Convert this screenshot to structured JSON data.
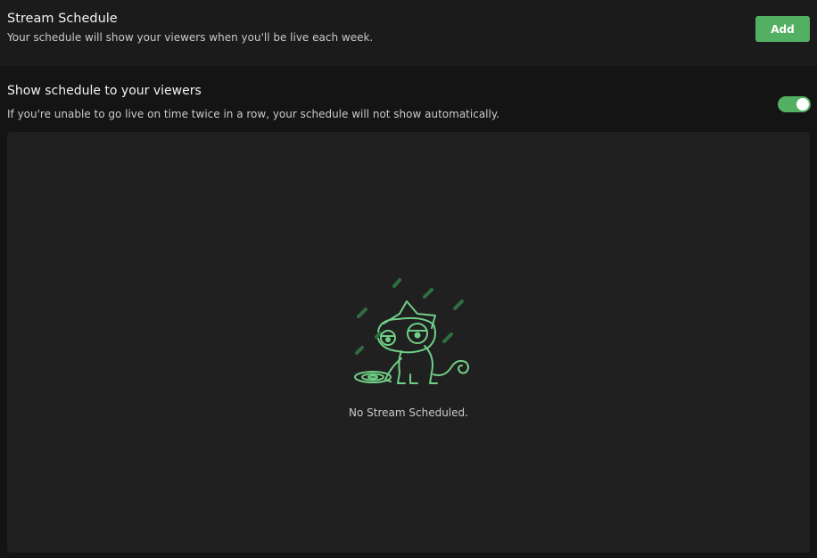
{
  "header": {
    "title": "Stream Schedule",
    "subtitle": "Your schedule will show your viewers when you'll be live each week.",
    "add_label": "Add"
  },
  "visibility": {
    "title": "Show schedule to your viewers",
    "description": "If you're unable to go live on time twice in a row, your schedule will not show automatically.",
    "toggle_on": true
  },
  "empty_state": {
    "message": "No Stream Scheduled.",
    "icon": "sleepy-chameleon-rain-icon"
  },
  "colors": {
    "accent": "#53b063",
    "illustration": "#6fcf86",
    "rain": "#2f6e41",
    "panel": "#202020",
    "background": "#141414"
  }
}
